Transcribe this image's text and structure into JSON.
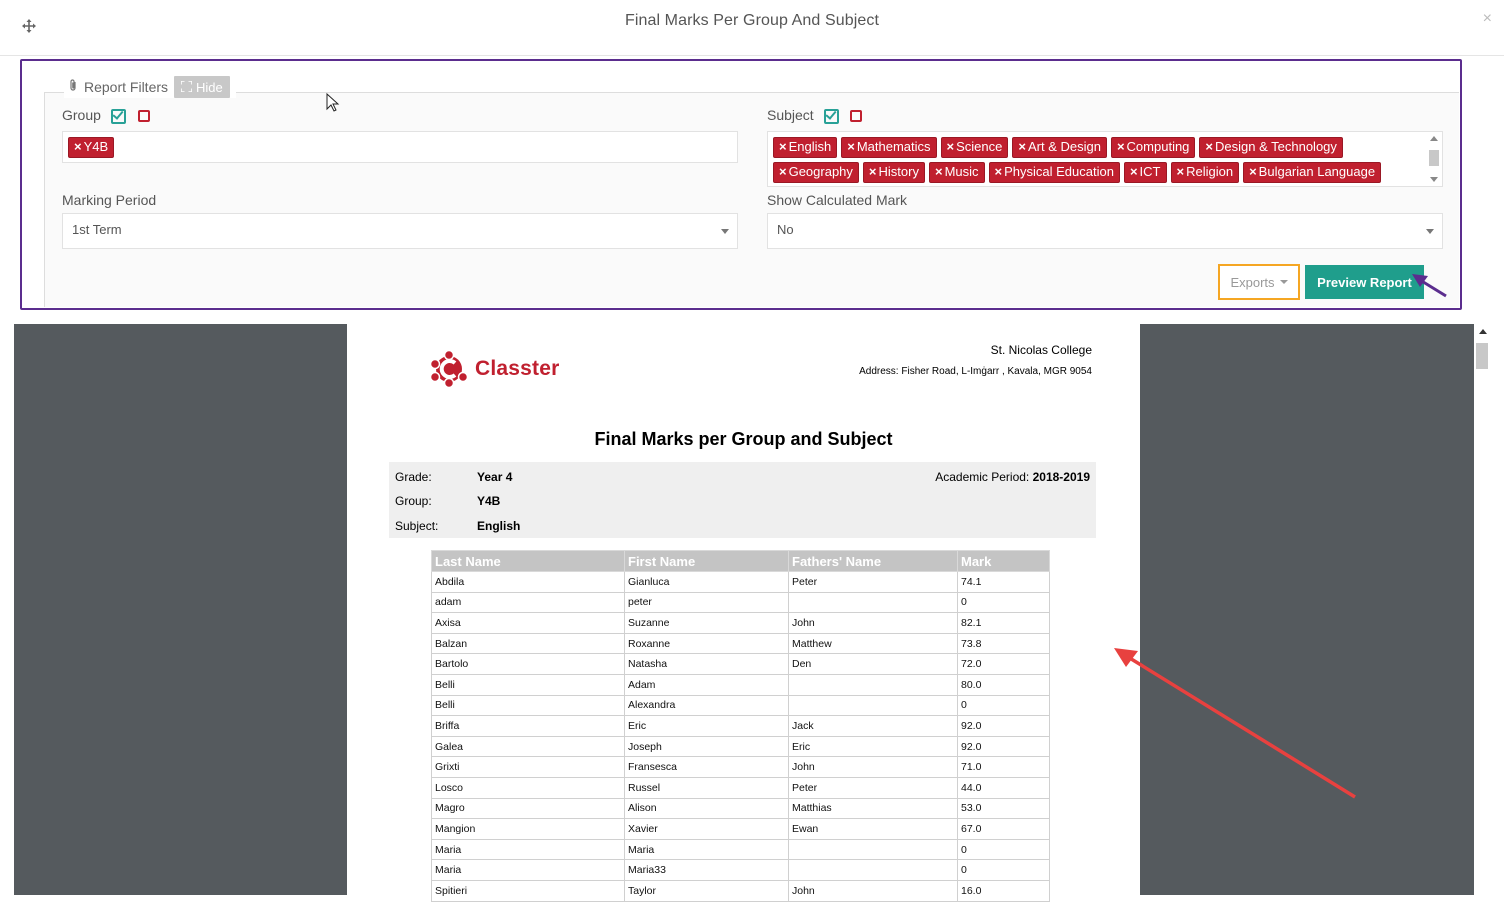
{
  "modal": {
    "title": "Final Marks Per Group And Subject",
    "move_icon": "move-icon",
    "close_symbol": "×"
  },
  "filters": {
    "legend_label": "Report Filters",
    "hide_label": "Hide",
    "group": {
      "label": "Group",
      "tags": [
        "Y4B"
      ]
    },
    "subject": {
      "label": "Subject",
      "tags": [
        "English",
        "Mathematics",
        "Science",
        "Art & Design",
        "Computing",
        "Design & Technology",
        "Geography",
        "History",
        "Music",
        "Physical Education",
        "ICT",
        "Religion",
        "Bulgarian Language"
      ]
    },
    "marking_period": {
      "label": "Marking Period",
      "value": "1st Term"
    },
    "show_calculated_mark": {
      "label": "Show Calculated Mark",
      "value": "No"
    },
    "exports_label": "Exports",
    "preview_label": "Preview Report"
  },
  "colors": {
    "accent_teal": "#1f9e8c",
    "tag_red": "#c0202f",
    "panel_border": "#5b2d8e",
    "exports_border": "#f5a623",
    "annotation_arrow": "#e8413f"
  },
  "report": {
    "logo_text": "Classter",
    "college_name": "St. Nicolas College",
    "college_address": "Address: Fisher Road, L-Imġarr , Kavala, MGR 9054",
    "title": "Final Marks per Group and Subject",
    "grade_label": "Grade:",
    "grade_value": "Year 4",
    "group_label": "Group:",
    "group_value": "Y4B",
    "subject_label": "Subject:",
    "subject_value": "English",
    "academic_label": "Academic Period:",
    "academic_value": "2018-2019",
    "columns": [
      "Last Name",
      "First Name",
      "Fathers' Name",
      "Mark"
    ],
    "rows": [
      [
        "Abdila",
        "Gianluca",
        "Peter",
        "74.1"
      ],
      [
        "adam",
        "peter",
        "",
        "0"
      ],
      [
        "Axisa",
        "Suzanne",
        "John",
        "82.1"
      ],
      [
        "Balzan",
        "Roxanne",
        "Matthew",
        "73.8"
      ],
      [
        "Bartolo",
        "Natasha",
        "Den",
        "72.0"
      ],
      [
        "Belli",
        "Adam",
        "",
        "80.0"
      ],
      [
        "Belli",
        "Alexandra",
        "",
        "0"
      ],
      [
        "Briffa",
        "Eric",
        "Jack",
        "92.0"
      ],
      [
        "Galea",
        "Joseph",
        "Eric",
        "92.0"
      ],
      [
        "Grixti",
        "Fransesca",
        "John",
        "71.0"
      ],
      [
        "Losco",
        "Russel",
        "Peter",
        "44.0"
      ],
      [
        "Magro",
        "Alison",
        "Matthias",
        "53.0"
      ],
      [
        "Mangion",
        "Xavier",
        "Ewan",
        "67.0"
      ],
      [
        "Maria",
        "Maria",
        "",
        "0"
      ],
      [
        "Maria",
        "Maria33",
        "",
        "0"
      ],
      [
        "Spitieri",
        "Taylor",
        "John",
        "16.0"
      ]
    ]
  }
}
